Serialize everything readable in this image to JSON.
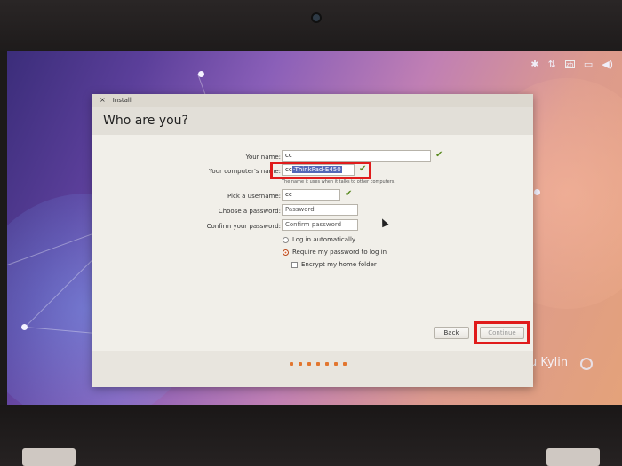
{
  "dialog": {
    "window_title": "Install",
    "close_glyph": "×",
    "heading": "Who are you?"
  },
  "form": {
    "your_name": {
      "label": "Your name:",
      "value": "cc"
    },
    "computer_name": {
      "label": "Your computer's name:",
      "value_prefix": "cc",
      "value_selected": "-ThinkPad-E450",
      "hint": "The name it uses when it talks to other computers."
    },
    "username": {
      "label": "Pick a username:",
      "value": "cc"
    },
    "password": {
      "label": "Choose a password:",
      "placeholder": "Password"
    },
    "confirm": {
      "label": "Confirm your password:",
      "placeholder": "Confirm password"
    },
    "login_auto": "Log in automatically",
    "require_pw": "Require my password to log in",
    "encrypt_home": "Encrypt my home folder",
    "check_glyph": "✔"
  },
  "buttons": {
    "back": "Back",
    "continue": "Continue"
  },
  "progress": {
    "steps": 7,
    "current": 7
  },
  "brand_text": "u Kylin",
  "tray": [
    "✱",
    "⇅",
    "zh",
    "▭",
    "◀)"
  ],
  "colors": {
    "accent_orange": "#e0632d",
    "highlight_red": "#e01b1b",
    "check_green": "#5a8a20"
  },
  "icons": [
    "close-icon",
    "check-icon",
    "network-icon",
    "battery-icon",
    "volume-icon",
    "bluetooth-icon",
    "keyboard-icon",
    "mouse-cursor-icon",
    "ubuntu-kylin-logo-icon"
  ]
}
